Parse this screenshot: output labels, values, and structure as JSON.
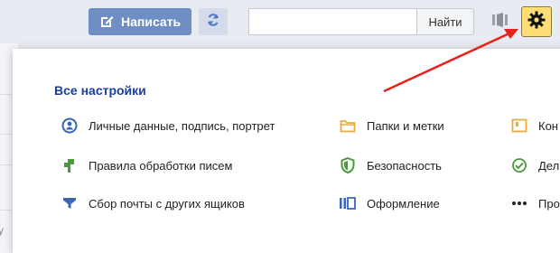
{
  "toolbar": {
    "compose_label": "Написать",
    "search_placeholder": "",
    "search_button_label": "Найти"
  },
  "background": {
    "partial_text": "у"
  },
  "settings_panel": {
    "title": "Все настройки",
    "items": [
      {
        "label": "Личные данные, подпись, портрет",
        "icon": "user-circle-icon",
        "color": "#3a64b6"
      },
      {
        "label": "Правила обработки писем",
        "icon": "rules-icon",
        "color": "#4a9a3c"
      },
      {
        "label": "Сбор почты с других ящиков",
        "icon": "funnel-icon",
        "color": "#3a64b6"
      },
      {
        "label": "Папки и метки",
        "icon": "folder-icon",
        "color": "#f0a93a"
      },
      {
        "label": "Безопасность",
        "icon": "shield-icon",
        "color": "#4a9a3c"
      },
      {
        "label": "Оформление",
        "icon": "theme-icon",
        "color": "#3a64b6"
      },
      {
        "label": "Кон",
        "icon": "contacts-icon",
        "color": "#f0a93a"
      },
      {
        "label": "Дел",
        "icon": "check-circle-icon",
        "color": "#4a9a3c"
      },
      {
        "label": "Про",
        "icon": "more-icon",
        "color": "#222222"
      }
    ]
  },
  "colors": {
    "compose_bg": "#6f8fc4",
    "gear_bg": "#ffdf75",
    "title": "#1a3ea3",
    "arrow": "#e8201a"
  }
}
